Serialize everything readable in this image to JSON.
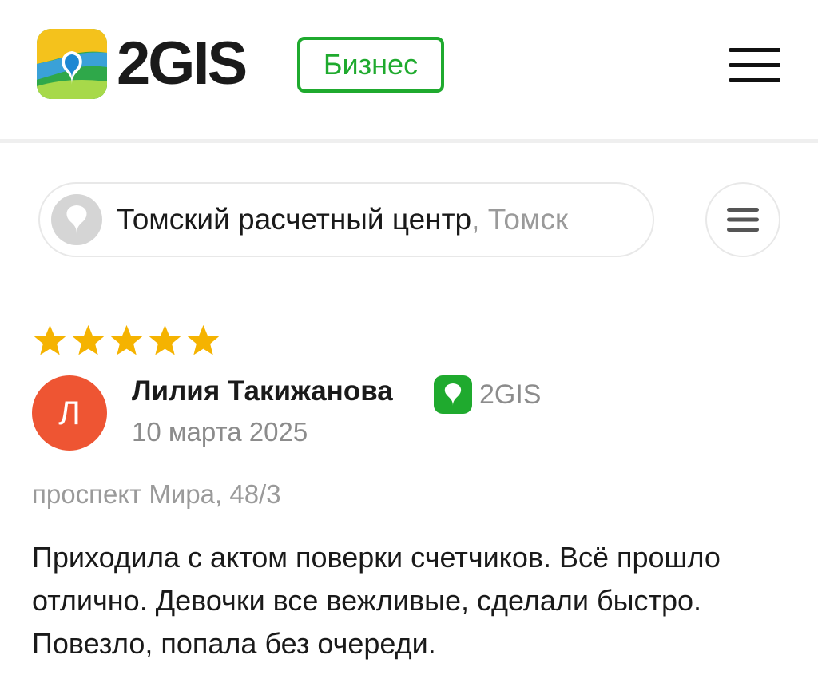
{
  "header": {
    "brand": "2GIS",
    "badge": "Бизнес",
    "logo_icon": "2gis-logo-icon",
    "menu_icon": "hamburger-menu-icon"
  },
  "org": {
    "name": "Томский расчетный центр",
    "city": ", Томск",
    "icon": "org-placeholder-icon",
    "filter_icon": "filter-lines-icon"
  },
  "review": {
    "rating": 5,
    "rating_max": 5,
    "author_initial": "Л",
    "author_name": "Лилия Такижанова",
    "source_label": "2GIS",
    "date": "10 марта 2025",
    "address": "проспект Мира, 48/3",
    "text": "Приходила с актом поверки счетчиков. Всё прошло отлично. Девочки все вежливые, сделали быстро. Повезло, попала без очереди."
  },
  "colors": {
    "brand_green": "#1faa2e",
    "star": "#f5b301",
    "avatar": "#ee5533",
    "muted_text": "#8c8c8c"
  }
}
